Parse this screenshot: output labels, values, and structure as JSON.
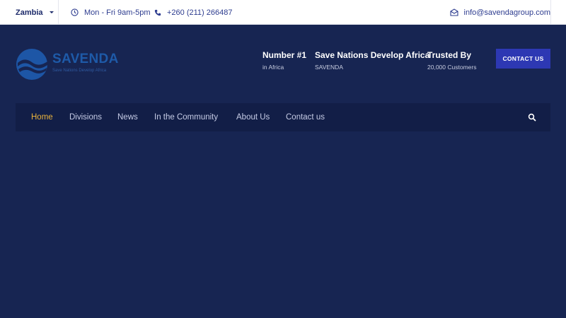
{
  "topbar": {
    "country": "Zambia",
    "hours": "Mon - Fri 9am-5pm",
    "phone": "+260 (211) 266487",
    "email": "info@savendagroup.com",
    "icons": {
      "hours": "clock-icon",
      "phone": "phone-icon",
      "email": "envelope-icon",
      "country": "chevron-down-icon"
    }
  },
  "header": {
    "logo": {
      "brand": "SAVENDA",
      "tagline": "Save Nations Develop Africa"
    },
    "info": [
      {
        "title": "Number #1",
        "subtitle": "in Africa"
      },
      {
        "title": "Save Nations Develop Africa",
        "subtitle": "SAVENDA"
      },
      {
        "title": "Trusted By",
        "subtitle": "20,000 Customers"
      }
    ],
    "cta_label": "CONTACT US"
  },
  "nav": {
    "items": [
      {
        "label": "Home",
        "active": true
      },
      {
        "label": "Divisions",
        "active": false
      },
      {
        "label": "News",
        "active": false
      },
      {
        "label": "In the Community",
        "active": false
      },
      {
        "label": "About Us",
        "active": false
      },
      {
        "label": "Contact us",
        "active": false
      }
    ],
    "search_icon": "search-icon"
  },
  "colors": {
    "page_bg": "#172552",
    "nav_bg": "#121e47",
    "accent": "#e8b23c",
    "button": "#2d38b3",
    "topbar_text": "#2d3c8f"
  }
}
